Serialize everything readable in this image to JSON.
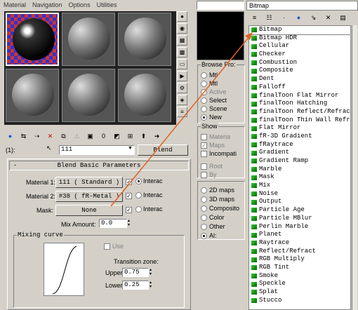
{
  "menu": [
    "Material",
    "Navigation",
    "Options",
    "Utilities"
  ],
  "side_icons": [
    "sphere-icon",
    "backlight-icon",
    "background-icon",
    "tiling-icon",
    "video-color-icon",
    "make-preview-icon",
    "options-icon",
    "select-by-material-icon",
    "material-navigator-icon"
  ],
  "toolbar_icons": [
    "get-material-icon",
    "put-to-scene-icon",
    "assign-to-selection-icon",
    "reset-icon",
    "make-copy-icon",
    "make-unique-icon",
    "put-to-library-icon",
    "material-effects-channel-icon",
    "show-map-icon",
    "show-end-result-icon",
    "go-to-parent-icon",
    "go-forward-icon"
  ],
  "name_row": {
    "prefix": "(1):",
    "name": "111",
    "type_button": "Blend"
  },
  "rollout": {
    "title": "Blend Basic Parameters",
    "material1_label": "Material 1:",
    "material1_value": "111  ( Standard )",
    "material2_label": "Material 2:",
    "material2_value": "#38  ( fR-Metal )",
    "mask_label": "Mask:",
    "mask_value": "None",
    "interactive": "Interac",
    "mix_amount_label": "Mix Amount:",
    "mix_amount_value": "0.0",
    "mixing_curve_label": "Mixing curve",
    "use_label": "Use",
    "transition_zone_label": "Transition zone:",
    "upper_label": "Upper:",
    "upper_value": "0.75",
    "lower_label": "Lower:",
    "lower_value": "0.25"
  },
  "browser": {
    "title": "Bitmap",
    "browse_from_label": "Browse Fro:",
    "browse_from": [
      "Mtl",
      "Mtl",
      "Active",
      "Select",
      "Scene",
      "New"
    ],
    "show_label": "Show",
    "show": [
      "Materia",
      "Maps",
      "Incompati",
      "Root",
      "By"
    ],
    "map_types": [
      "2D maps",
      "3D maps",
      "Composito",
      "Color",
      "Other",
      "Al:"
    ],
    "maps": [
      "Bitmap",
      "Bitmap HDR",
      "Cellular",
      "Checker",
      "Combustion",
      "Composite",
      "Dent",
      "Falloff",
      "finalToon Flat Mirror",
      "finalToon Hatching",
      "finalToon Reflect/Refract",
      "finalToon Thin Wall Refra",
      "Flat Mirror",
      "fR-3D Gradient",
      "fRaytrace",
      "Gradient",
      "Gradient Ramp",
      "Marble",
      "Mask",
      "Mix",
      "Noise",
      "Output",
      "Particle Age",
      "Particle MBlur",
      "Perlin Marble",
      "Planet",
      "Raytrace",
      "Reflect/Refract",
      "RGB Multiply",
      "RGB Tint",
      "Smoke",
      "Speckle",
      "Splat",
      "Stucco"
    ]
  },
  "colors": {
    "arrow": "#e06020",
    "icon_green": "#33aa33"
  }
}
